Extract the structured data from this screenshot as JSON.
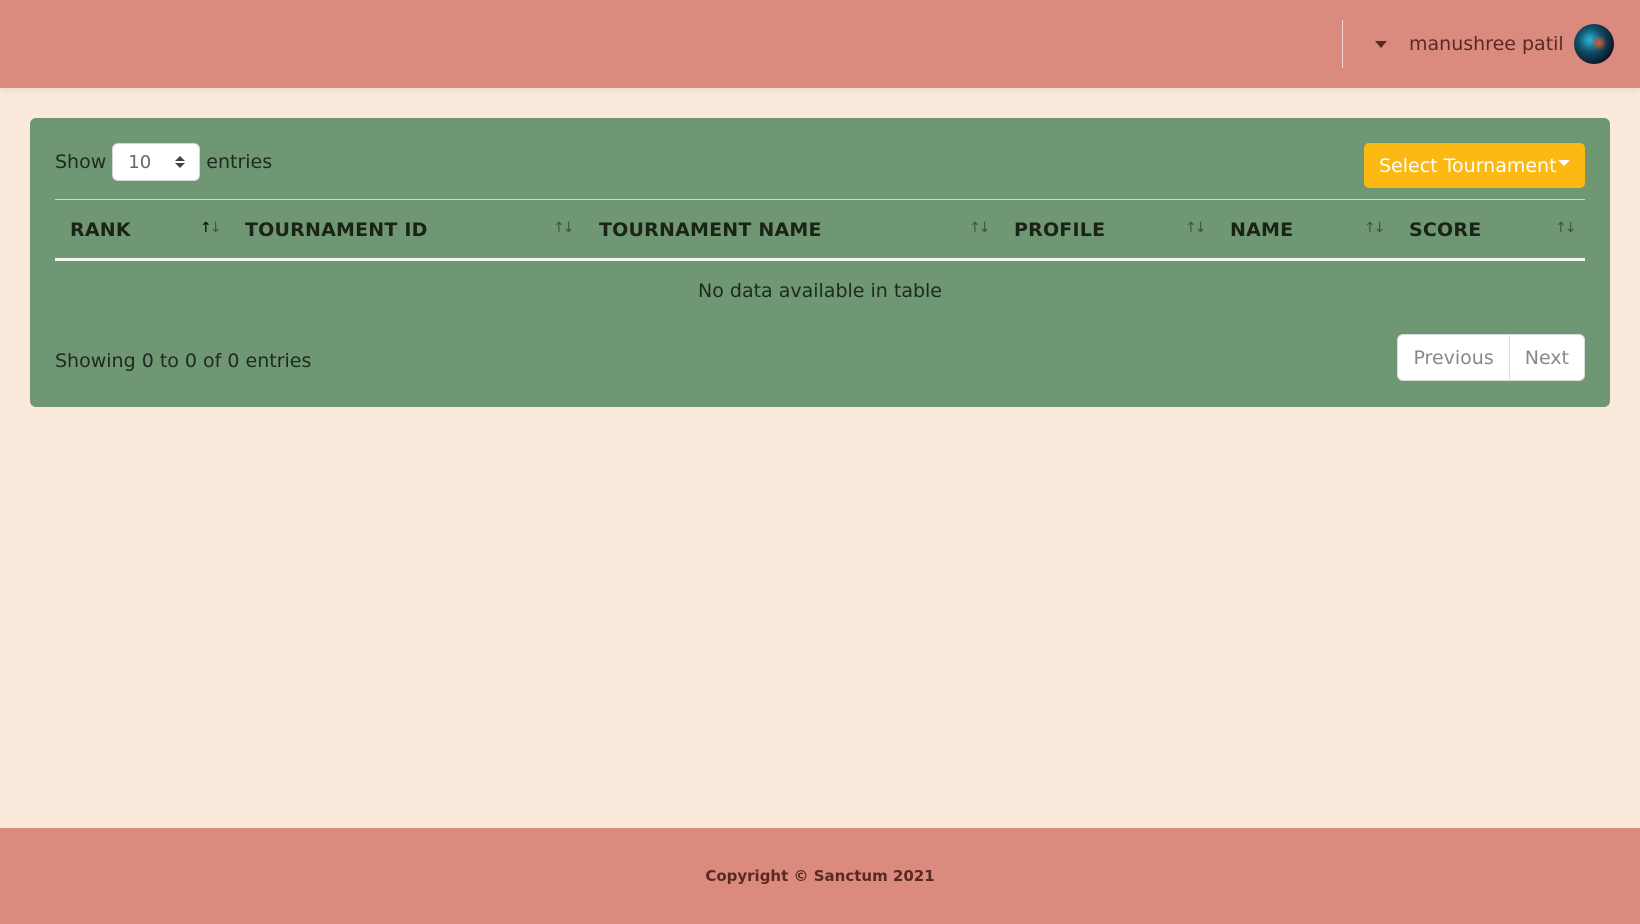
{
  "header": {
    "username": "manushree patil",
    "avatar_icon": "user-avatar"
  },
  "controls": {
    "show_label": "Show",
    "entries_value": "10",
    "entries_label": "entries",
    "select_tournament_label": "Select Tournament",
    "select_tournament_color": "#fdb913"
  },
  "table": {
    "columns": [
      {
        "label": "RANK",
        "sort": "ascending"
      },
      {
        "label": "TOURNAMENT ID",
        "sort": "none"
      },
      {
        "label": "TOURNAMENT NAME",
        "sort": "none"
      },
      {
        "label": "PROFILE",
        "sort": "none"
      },
      {
        "label": "NAME",
        "sort": "none"
      },
      {
        "label": "SCORE",
        "sort": "none"
      }
    ],
    "empty_message": "No data available in table"
  },
  "pagination": {
    "info": "Showing 0 to 0 of 0 entries",
    "previous_label": "Previous",
    "next_label": "Next"
  },
  "footer": {
    "copyright": "Copyright © Sanctum 2021"
  },
  "colors": {
    "header_bg": "#db8a7e",
    "page_bg": "#fbeadc",
    "card_bg": "#6f9774",
    "accent": "#fdb913"
  }
}
